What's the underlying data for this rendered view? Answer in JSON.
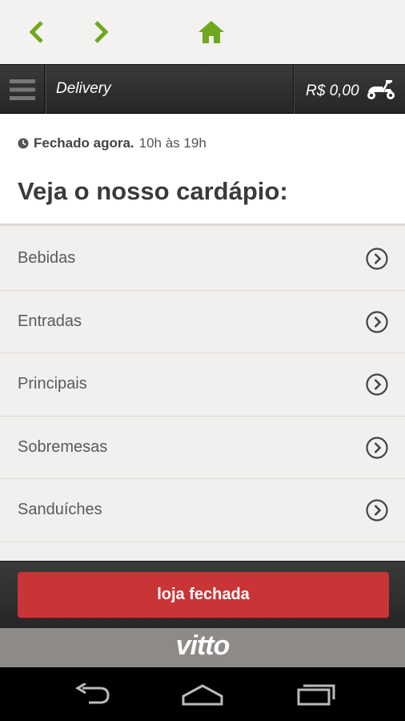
{
  "browser_nav": {
    "back_icon": "chevron-left-icon",
    "forward_icon": "chevron-right-icon",
    "home_icon": "home-icon",
    "accent_color": "#6fa81d"
  },
  "appbar": {
    "menu_icon": "hamburger-menu-icon",
    "title": "Delivery",
    "cart_total": "R$ 0,00",
    "cart_icon": "scooter-icon"
  },
  "status": {
    "closed_label": "Fechado agora.",
    "hours": "10h às 19h",
    "clock_icon": "clock-icon"
  },
  "menu": {
    "heading": "Veja o nosso cardápio:",
    "categories": [
      {
        "label": "Bebidas"
      },
      {
        "label": "Entradas"
      },
      {
        "label": "Principais"
      },
      {
        "label": "Sobremesas"
      },
      {
        "label": "Sanduíches"
      }
    ]
  },
  "footer": {
    "closed_button_label": "loja fechada",
    "button_color": "#c93537",
    "brand": "vitto"
  },
  "system_nav": {
    "back_icon": "android-back-icon",
    "home_icon": "android-home-icon",
    "recents_icon": "android-recents-icon"
  }
}
